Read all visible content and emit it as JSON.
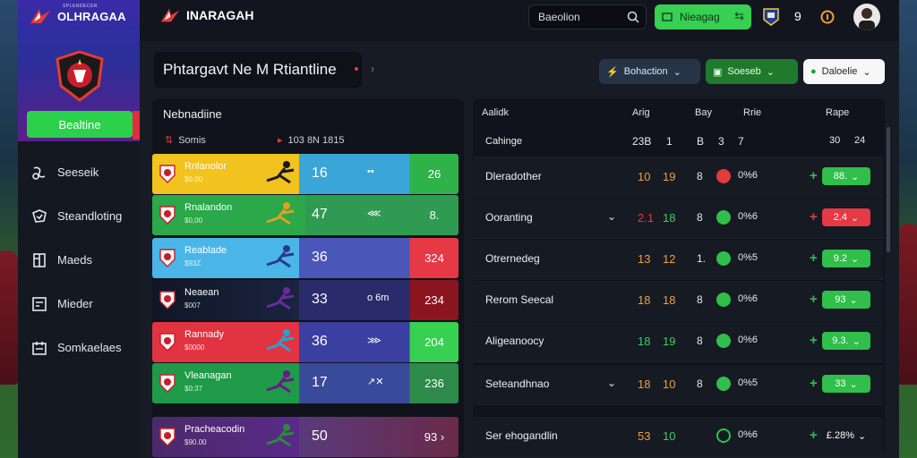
{
  "sidebar": {
    "brand": "OLHRAGAA",
    "brand_sub": "SPLENDECER",
    "cta": "Bealtine",
    "items": [
      {
        "label": "Seeseik",
        "icon": "ball-icon"
      },
      {
        "label": "Steandloting",
        "icon": "shield-check-icon"
      },
      {
        "label": "Maeds",
        "icon": "book-icon"
      },
      {
        "label": "Mieder",
        "icon": "box-icon"
      },
      {
        "label": "Somkaelaes",
        "icon": "calendar-icon"
      }
    ]
  },
  "topbar": {
    "brand": "INARAGAH",
    "search_value": "Baeolion",
    "balance_label": "Nieagag",
    "count": "9"
  },
  "headline": "Phtargavt Ne M Rtiantline",
  "filters": {
    "a": "Bohaction",
    "b": "Soeseb",
    "c": "Daloelie"
  },
  "left": {
    "title": "Nebnadiine",
    "sub1": "Somis",
    "sub2": "103  8N 1815",
    "rows": [
      {
        "team": "Rnlanolor",
        "sub": "$0.00",
        "value": "16",
        "mid": "••",
        "end": "26"
      },
      {
        "team": "Rnalandon",
        "sub": "$0,00",
        "value": "47",
        "mid": "⋘",
        "end": "8."
      },
      {
        "team": "Reablade",
        "sub": "$93Z",
        "value": "36",
        "mid": "",
        "end": "324"
      },
      {
        "team": "Neaean",
        "sub": "$007",
        "value": "33",
        "mid": "o   6m",
        "end": "234"
      },
      {
        "team": "Rannady",
        "sub": "$0000",
        "value": "36",
        "mid": "⋙",
        "end": "204"
      },
      {
        "team": "Vleanagan",
        "sub": "$0:37",
        "value": "17",
        "mid": "↗✕",
        "end": "236"
      },
      {
        "team": "Pracheacodin",
        "sub": "$90.00",
        "value": "50",
        "mid": "",
        "end": "93 ›"
      }
    ]
  },
  "table": {
    "headers": {
      "name": "Aalidk",
      "c1": "Arig",
      "c2": "Bay",
      "c3": "Rrie",
      "c4": "Rape"
    },
    "subheader": {
      "name": "Cahinge",
      "n1": "23B",
      "n2": "1",
      "n3": "B",
      "n4": "3",
      "n5": "7",
      "p1": "30",
      "p2": "24"
    },
    "rows": [
      {
        "name": "Dleradother",
        "chev": "",
        "n1": "10",
        "n2": "19",
        "n3": "8",
        "icon": "red",
        "pct": "0%6",
        "sign": "+",
        "sign_color": "green",
        "pill": "88.",
        "pill_color": "green"
      },
      {
        "name": "Ooranting",
        "chev": "⌄",
        "n1": "2.1",
        "n2": "18",
        "n3": "8",
        "icon": "green",
        "pct": "0%6",
        "sign": "+",
        "sign_color": "red",
        "pill": "2.4",
        "pill_color": "red"
      },
      {
        "name": "Otrernedeg",
        "chev": "",
        "n1": "13",
        "n2": "12",
        "n3": "1.",
        "icon": "green",
        "pct": "0%5",
        "sign": "+",
        "sign_color": "green",
        "pill": "9.2",
        "pill_color": "green"
      },
      {
        "name": "Rerom Seecal",
        "chev": "",
        "n1": "18",
        "n2": "18",
        "n3": "8",
        "icon": "green",
        "pct": "0%6",
        "sign": "+",
        "sign_color": "green",
        "pill": "93",
        "pill_color": "green"
      },
      {
        "name": "Aligeanoocy",
        "chev": "",
        "n1": "18",
        "n2": "19",
        "n3": "8",
        "icon": "green",
        "pct": "0%6",
        "sign": "+",
        "sign_color": "green",
        "pill": "9.3.",
        "pill_color": "green"
      },
      {
        "name": "Seteandhnao",
        "chev": "⌄",
        "n1": "18",
        "n2": "10",
        "n3": "8",
        "icon": "green",
        "pct": "0%5",
        "sign": "+",
        "sign_color": "green",
        "pill": "33",
        "pill_color": "green"
      },
      {
        "name": "Ser ehogandlin",
        "chev": "",
        "n1": "53",
        "n2": "10",
        "n3": "",
        "icon": "green-ring",
        "pct": "0%6",
        "sign": "+",
        "sign_color": "green",
        "pill": "£.28%",
        "pill_color": "none"
      }
    ]
  },
  "colors": {
    "accent_green": "#37d052",
    "accent_red": "#e53946",
    "panel": "#10131b"
  }
}
